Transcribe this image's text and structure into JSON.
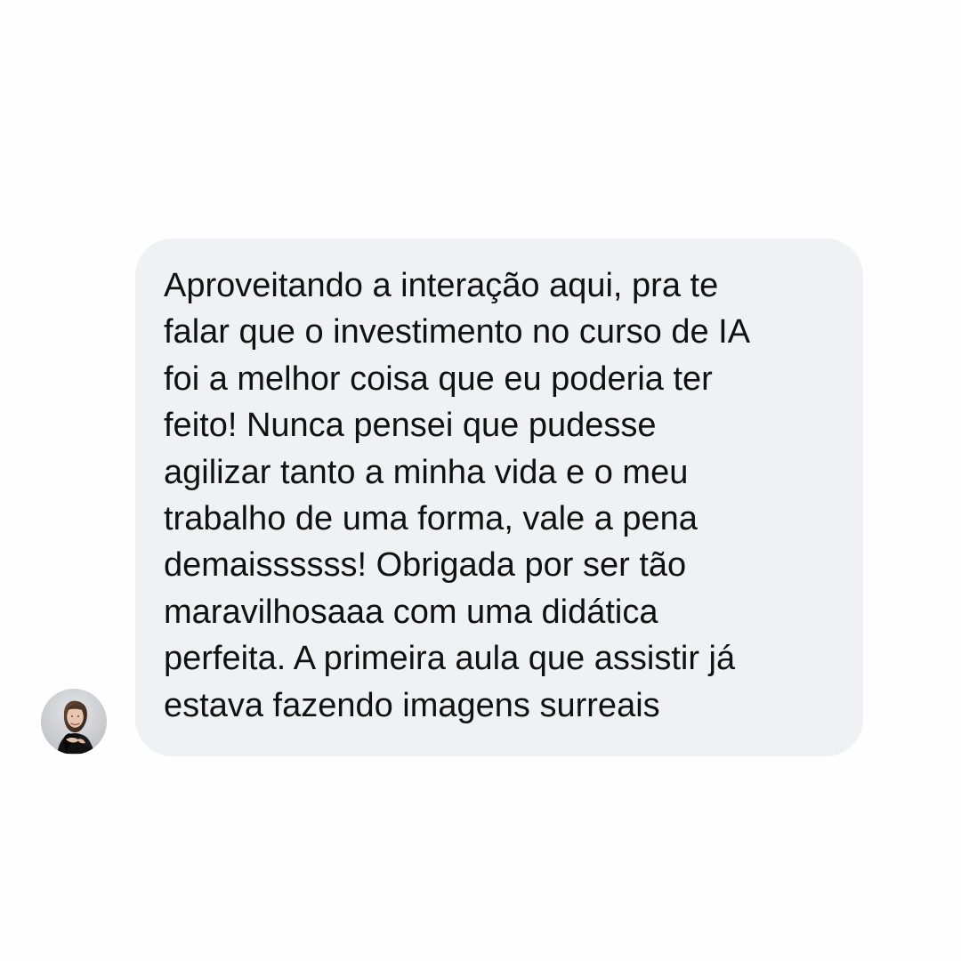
{
  "chat": {
    "avatar_icon": "person-avatar-icon",
    "background_color": "#fefefe",
    "bubble_color": "#f0f1f4",
    "text_color": "#111111",
    "message": {
      "lines": [
        "Aproveitando a interação aqui, pra te",
        "falar que o investimento no curso de IA",
        "foi a melhor coisa que eu poderia ter",
        "feito! Nunca pensei que pudesse",
        "agilizar tanto a minha vida e o meu",
        "trabalho de uma forma, vale a pena",
        "demaissssss! Obrigada por ser tão",
        "maravilhosaaa com uma didática",
        "perfeita. A primeira aula que assistir já",
        "estava fazendo imagens surreais"
      ]
    }
  }
}
